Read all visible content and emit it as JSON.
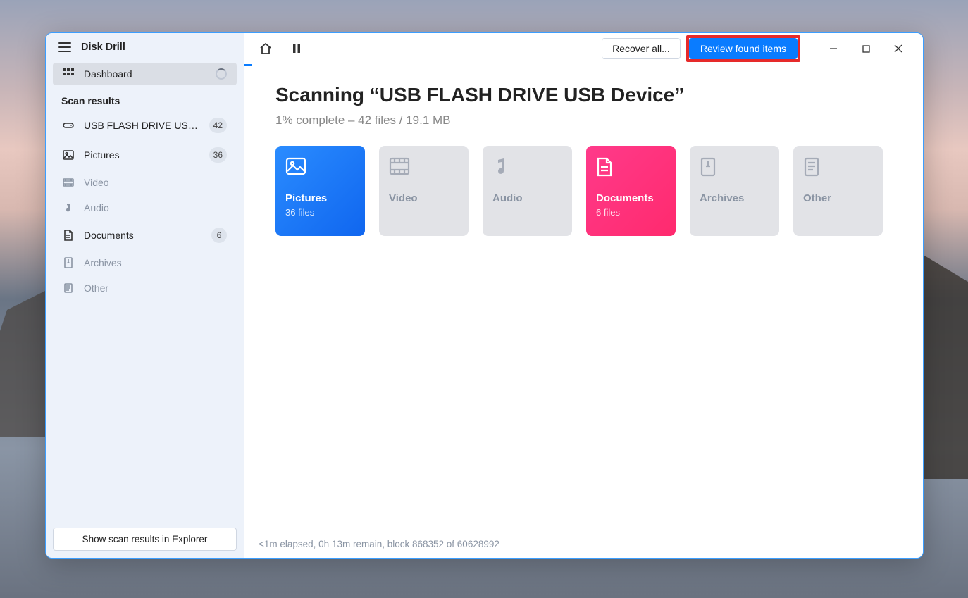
{
  "app": {
    "title": "Disk Drill"
  },
  "sidebar": {
    "dashboard_label": "Dashboard",
    "section_title": "Scan results",
    "items": [
      {
        "label": "USB FLASH DRIVE USB D...",
        "count": "42"
      },
      {
        "label": "Pictures",
        "count": "36"
      },
      {
        "label": "Video",
        "count": ""
      },
      {
        "label": "Audio",
        "count": ""
      },
      {
        "label": "Documents",
        "count": "6"
      },
      {
        "label": "Archives",
        "count": ""
      },
      {
        "label": "Other",
        "count": ""
      }
    ],
    "footer_button": "Show scan results in Explorer"
  },
  "topbar": {
    "recover_label": "Recover all...",
    "review_label": "Review found items"
  },
  "main": {
    "title": "Scanning “USB FLASH DRIVE USB Device”",
    "subtitle": "1% complete – 42 files / 19.1 MB"
  },
  "cards": [
    {
      "title": "Pictures",
      "sub": "36 files"
    },
    {
      "title": "Video",
      "sub": "—"
    },
    {
      "title": "Audio",
      "sub": "—"
    },
    {
      "title": "Documents",
      "sub": "6 files"
    },
    {
      "title": "Archives",
      "sub": "—"
    },
    {
      "title": "Other",
      "sub": "—"
    }
  ],
  "status": "<1m elapsed, 0h 13m remain, block 868352 of 60628992"
}
